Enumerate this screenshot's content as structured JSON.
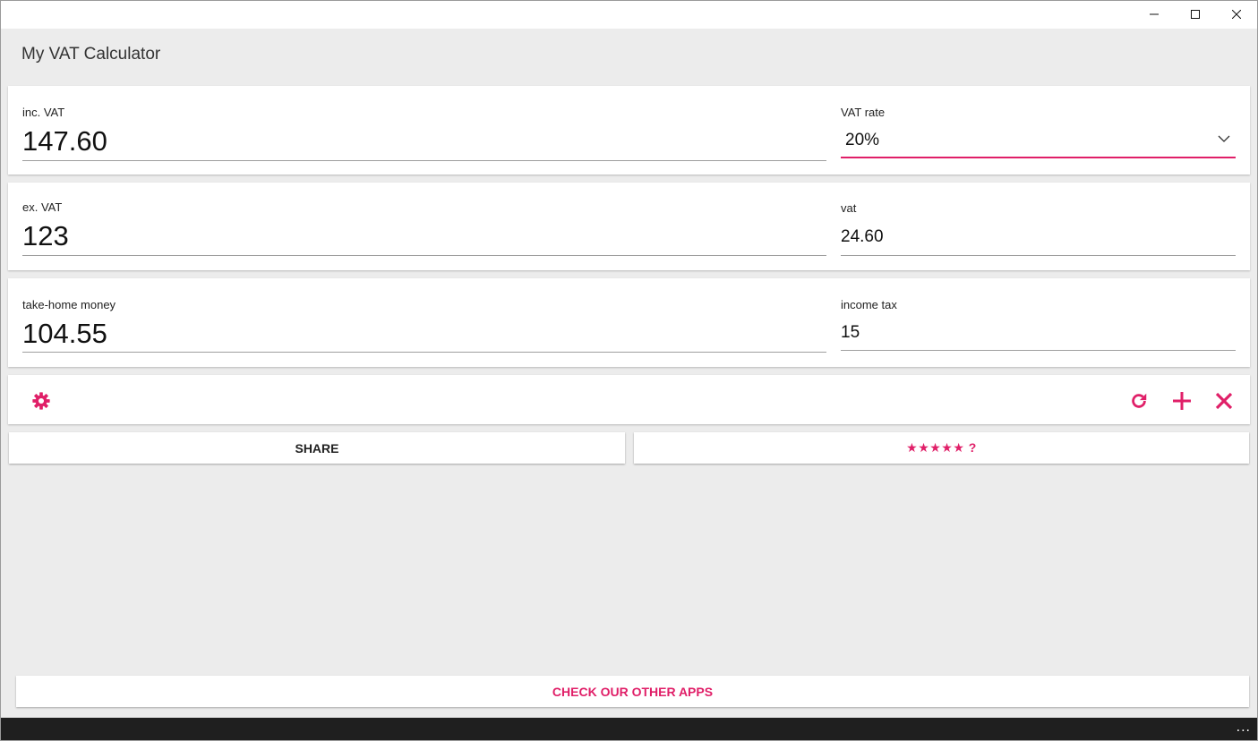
{
  "app": {
    "title": "My VAT Calculator"
  },
  "window_controls": {
    "minimize_icon": "minimize-icon",
    "maximize_icon": "maximize-icon",
    "close_icon": "close-icon"
  },
  "row1": {
    "inc_vat_label": "inc. VAT",
    "inc_vat_value": "147.60",
    "vat_rate_label": "VAT rate",
    "vat_rate_value": "20%"
  },
  "row2": {
    "ex_vat_label": "ex. VAT",
    "ex_vat_value": "123",
    "vat_label": "vat",
    "vat_value": "24.60"
  },
  "row3": {
    "take_home_label": "take-home money",
    "take_home_value": "104.55",
    "income_tax_label": "income tax",
    "income_tax_value": "15"
  },
  "toolbar": {
    "settings_icon": "gear-icon",
    "refresh_icon": "refresh-icon",
    "add_icon": "plus-icon",
    "clear_icon": "close-icon"
  },
  "buttons": {
    "share": "SHARE",
    "rate": "★★★★★ ?",
    "other_apps": "CHECK OUR OTHER APPS"
  },
  "bottom_bar": {
    "more": "..."
  },
  "colors": {
    "accent": "#e01f68",
    "background": "#ececec",
    "card": "#ffffff"
  }
}
